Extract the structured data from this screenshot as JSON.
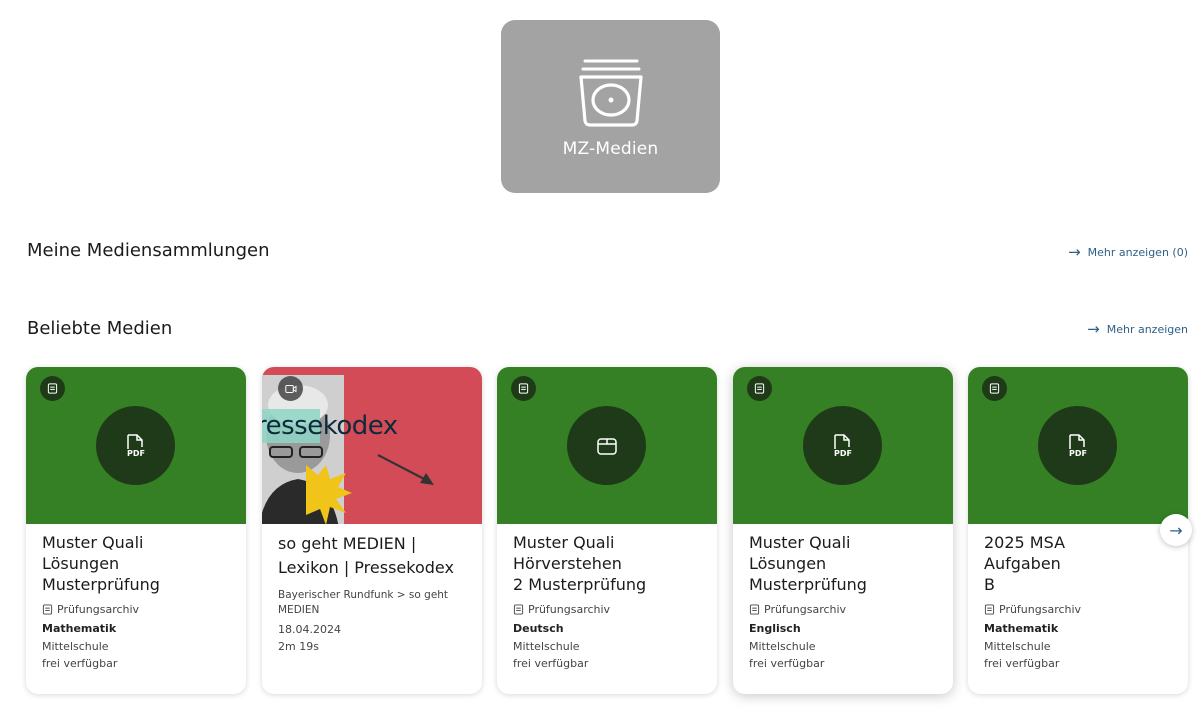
{
  "hero": {
    "label": "MZ-Medien",
    "icon": "media-stack-icon"
  },
  "sections": {
    "collections": {
      "title": "Meine Mediensammlungen",
      "more": "Mehr anzeigen (0)"
    },
    "popular": {
      "title": "Beliebte Medien",
      "more": "Mehr anzeigen"
    }
  },
  "colors": {
    "card_green": "#358024",
    "badge_dark": "#1f3a18",
    "link_blue": "#2f5f87",
    "hero_grey": "#a3a3a3"
  },
  "cards": [
    {
      "title": "Muster Quali\nLösungen\nMusterprüfung",
      "source": "Prüfungsarchiv",
      "subject": "Mathematik",
      "school": "Mittelschule",
      "availability": "frei verfügbar",
      "center_icon": "pdf-file-icon",
      "type_icon": "archive-icon"
    },
    {
      "title": "so geht MEDIEN |\nLexikon | Pressekodex",
      "source": "Bayerischer Rundfunk > so geht MEDIEN",
      "date": "18.04.2024",
      "duration": "2m 19s",
      "thumb_word": "ressekodex",
      "type_icon": "video-icon"
    },
    {
      "title": "Muster Quali\nHörverstehen\n2 Musterprüfung",
      "source": "Prüfungsarchiv",
      "subject": "Deutsch",
      "school": "Mittelschule",
      "availability": "frei verfügbar",
      "center_icon": "box-icon",
      "type_icon": "archive-icon"
    },
    {
      "title": "Muster Quali\nLösungen\nMusterprüfung",
      "source": "Prüfungsarchiv",
      "subject": "Englisch",
      "school": "Mittelschule",
      "availability": "frei verfügbar",
      "center_icon": "pdf-file-icon",
      "type_icon": "archive-icon"
    },
    {
      "title": "2025 MSA\nAufgaben\nB",
      "source": "Prüfungsarchiv",
      "subject": "Mathematik",
      "school": "Mittelschule",
      "availability": "frei verfügbar",
      "center_icon": "pdf-file-icon",
      "type_icon": "archive-icon"
    }
  ],
  "carousel": {
    "next_icon": "arrow-right-icon"
  }
}
